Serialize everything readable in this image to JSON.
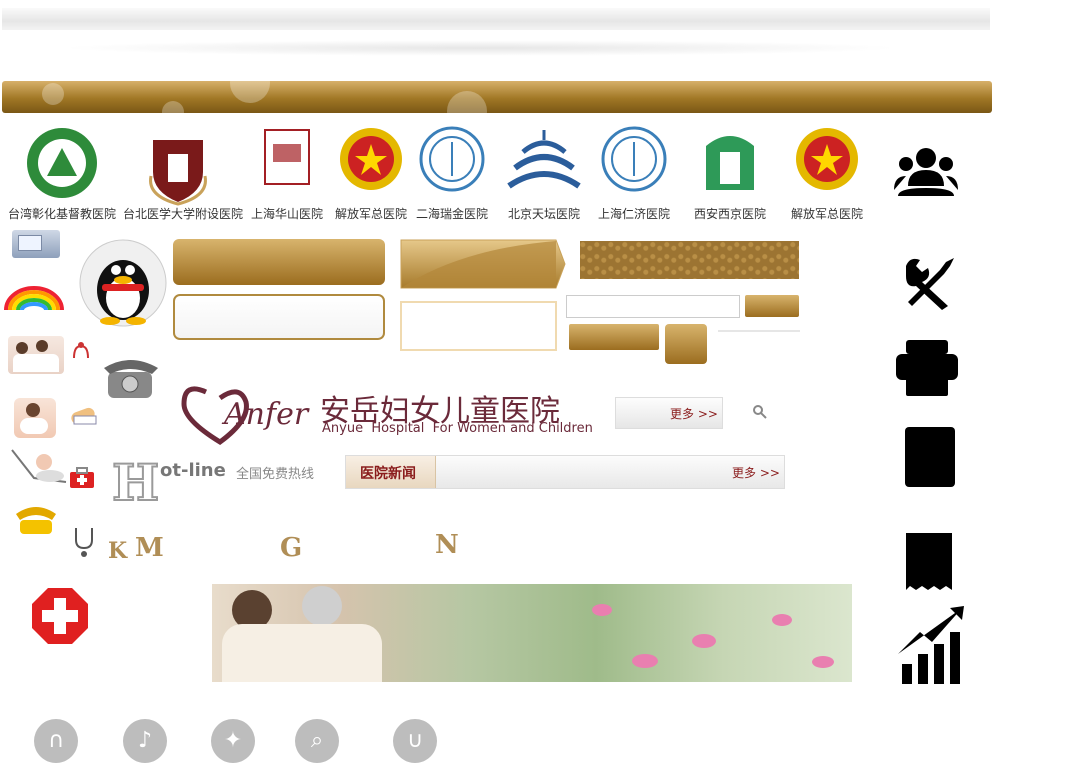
{
  "hospitals": [
    {
      "name": "台湾彰化基督教医院",
      "color": "#2e8b3a",
      "shape": "circle-green"
    },
    {
      "name": "台北医学大学附设医院",
      "color": "#7a1a1a",
      "shape": "shield"
    },
    {
      "name": "上海华山医院",
      "color": "#a31f24",
      "shape": "book"
    },
    {
      "name": "解放军总医院",
      "color": "#c22",
      "shape": "badge"
    },
    {
      "name": "二海瑞金医院",
      "color": "#3a7fb9",
      "shape": "circle-blue"
    },
    {
      "name": "北京天坛医院",
      "color": "#2b5d9b",
      "shape": "temple"
    },
    {
      "name": "上海仁济医院",
      "color": "#3a7fb9",
      "shape": "circle-blue2"
    },
    {
      "name": "西安西京医院",
      "color": "#2e9a58",
      "shape": "green-arch"
    },
    {
      "name": "解放军总医院",
      "color": "#c22",
      "shape": "badge"
    }
  ],
  "brand": {
    "logo_script": "Anfer",
    "name_cn": "安岳妇女儿童医院",
    "name_en": "Anyue  Hospital  For Women and Children"
  },
  "more_button": {
    "label": "更多 >>"
  },
  "hotline": {
    "letter": "H",
    "word": "ot-line",
    "label_cn": "全国免费热线"
  },
  "news_bar": {
    "title": "医院新闻",
    "more": "更多 >>"
  },
  "letters": {
    "k": "K",
    "m": "M",
    "g": "G",
    "n": "N"
  },
  "colors": {
    "gold": "#a07725",
    "sky": "#4aa9d8",
    "red": "#e02020",
    "brand_purple": "#6b2a3a"
  }
}
